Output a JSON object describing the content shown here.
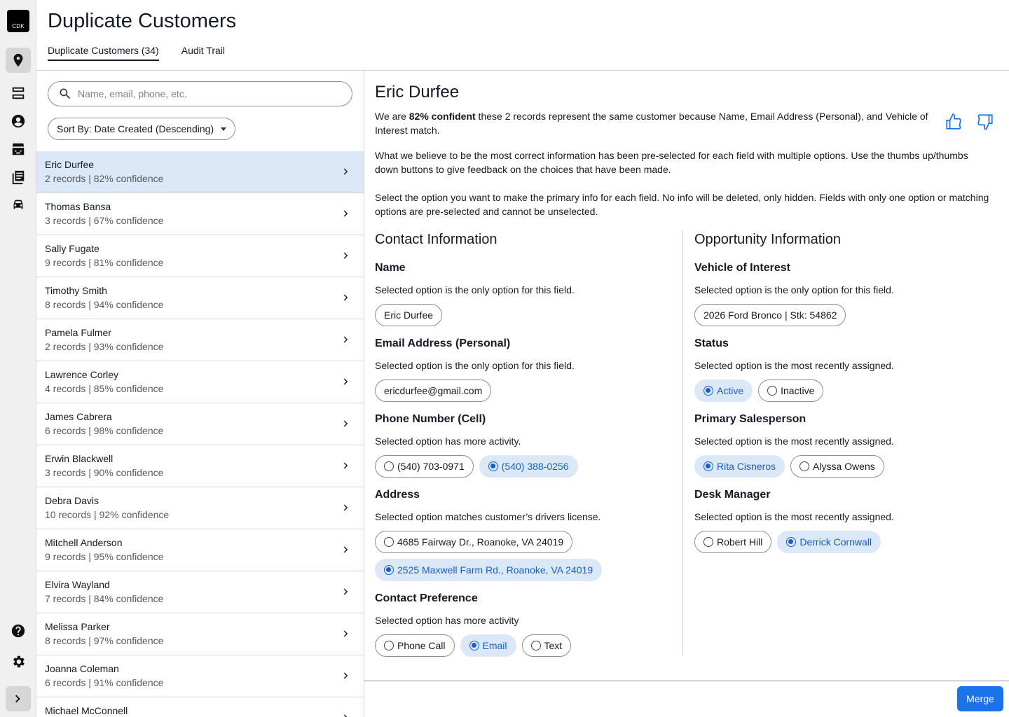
{
  "app": {
    "logo_text": "CDK"
  },
  "header": {
    "title": "Duplicate Customers",
    "tabs": [
      {
        "label": "Duplicate Customers (34)"
      },
      {
        "label": "Audit Trail"
      }
    ]
  },
  "search": {
    "placeholder": "Name, email, phone, etc."
  },
  "sort": {
    "label": "Sort By: Date Created (Descending)"
  },
  "customers": [
    {
      "name": "Eric Durfee",
      "meta": "2 records | 82% confidence"
    },
    {
      "name": "Thomas Bansa",
      "meta": "3 records | 67% confidence"
    },
    {
      "name": "Sally Fugate",
      "meta": "9 records | 81% confidence"
    },
    {
      "name": "Timothy Smith",
      "meta": "8 records | 94% confidence"
    },
    {
      "name": "Pamela Fulmer",
      "meta": "2 records | 93% confidence"
    },
    {
      "name": "Lawrence Corley",
      "meta": "4 records | 85% confidence"
    },
    {
      "name": "James Cabrera",
      "meta": "6 records | 98% confidence"
    },
    {
      "name": "Erwin Blackwell",
      "meta": "3 records | 90% confidence"
    },
    {
      "name": "Debra Davis",
      "meta": "10 records | 92% confidence"
    },
    {
      "name": "Mitchell Anderson",
      "meta": "9 records | 95% confidence"
    },
    {
      "name": "Elvira Wayland",
      "meta": "7 records | 84% confidence"
    },
    {
      "name": "Melissa Parker",
      "meta": "8 records | 97% confidence"
    },
    {
      "name": "Joanna Coleman",
      "meta": "6 records | 91% confidence"
    },
    {
      "name": "Michael McConnell",
      "meta": ""
    }
  ],
  "detail": {
    "name": "Eric Durfee",
    "p1_pre": "We are ",
    "p1_bold": "82% confident",
    "p1_post": " these 2 records represent the same customer because Name, Email Address (Personal), and Vehicle of Interest match.",
    "p2": "What we believe to be the most correct information has been pre-selected for each field with multiple options. Use the thumbs up/thumbs down buttons to give feedback on the choices that have been made.",
    "p3": "Select the option you want to make the primary info for each field. No info will be deleted, only hidden. Fields with only one option or matching options are pre-selected and cannot be unselected.",
    "contact": {
      "title": "Contact Information",
      "name": {
        "label": "Name",
        "desc": "Selected option is the only option for this field.",
        "options": [
          "Eric Durfee"
        ]
      },
      "email": {
        "label": "Email Address (Personal)",
        "desc": "Selected option is the only option for this field.",
        "options": [
          "ericdurfee@gmail.com"
        ]
      },
      "phone": {
        "label": "Phone Number (Cell)",
        "desc": "Selected option has more activity.",
        "options": [
          "(540) 703-0971",
          "(540) 388-0256"
        ]
      },
      "address": {
        "label": "Address",
        "desc": "Selected option matches customer’s drivers license.",
        "options": [
          "4685 Fairway Dr., Roanoke, VA 24019",
          "2525 Maxwell Farm Rd., Roanoke, VA 24019"
        ]
      },
      "pref": {
        "label": "Contact Preference",
        "desc": "Selected option has more activity",
        "options": [
          "Phone Call",
          "Email",
          "Text"
        ]
      }
    },
    "opportunity": {
      "title": "Opportunity Information",
      "vehicle": {
        "label": "Vehicle of Interest",
        "desc": "Selected option is the only option for this field.",
        "options": [
          "2026 Ford Bronco | Stk: 54862"
        ]
      },
      "status": {
        "label": "Status",
        "desc": "Selected option is the most recently assigned.",
        "options": [
          "Active",
          "Inactive"
        ]
      },
      "salesperson": {
        "label": "Primary Salesperson",
        "desc": "Selected option is the most recently assigned.",
        "options": [
          "Rita Cisneros",
          "Alyssa Owens"
        ]
      },
      "manager": {
        "label": "Desk Manager",
        "desc": "Selected option is the most recently assigned.",
        "options": [
          "Robert Hill",
          "Derrick Cornwall"
        ]
      }
    }
  },
  "footer": {
    "merge_label": "Merge"
  },
  "colors": {
    "accent": "#1a73e8",
    "selected_bg": "#dbe8f8"
  }
}
